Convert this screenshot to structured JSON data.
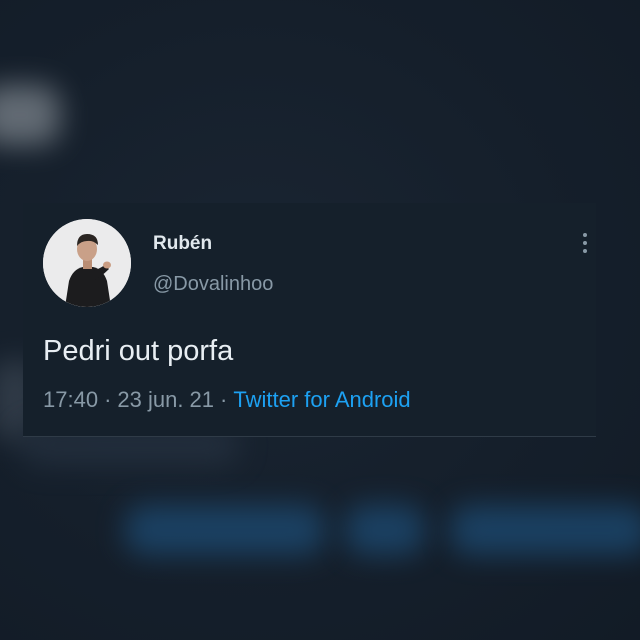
{
  "tweet": {
    "display_name": "Rubén",
    "handle": "@Dovalinhoo",
    "text": "Pedri out porfa",
    "time": "17:40",
    "separator": "·",
    "date": "23 jun. 21",
    "source": "Twitter for Android",
    "avatar_icon": "user-photo-avatar",
    "menu_icon": "more-vertical-icon"
  },
  "colors": {
    "background": "#15202b",
    "text_primary": "#e1e8ed",
    "text_secondary": "#8899a6",
    "link": "#1da1f2"
  }
}
